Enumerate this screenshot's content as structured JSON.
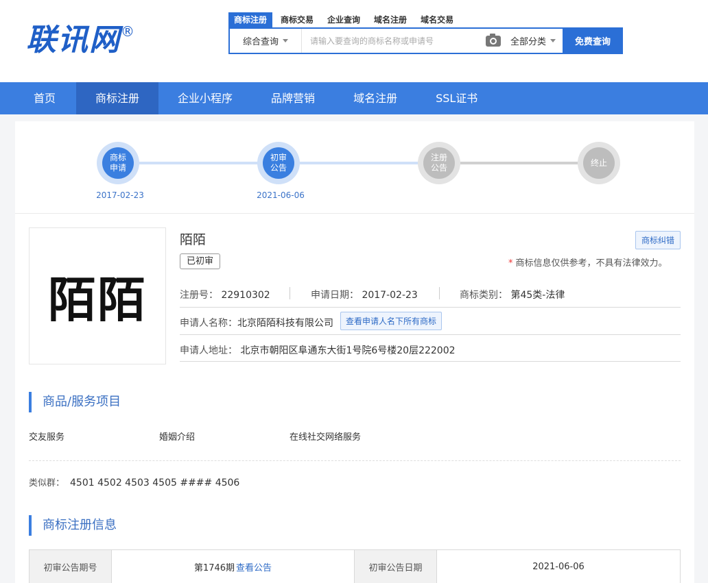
{
  "header": {
    "logo_text": "联讯网",
    "logo_reg": "®",
    "search_tabs": [
      "商标注册",
      "商标交易",
      "企业查询",
      "域名注册",
      "域名交易"
    ],
    "search_scope": "综合查询",
    "search_placeholder": "请输入要查询的商标名称或申请号",
    "category": "全部分类",
    "search_button": "免费查询"
  },
  "nav": [
    "首页",
    "商标注册",
    "企业小程序",
    "品牌营销",
    "域名注册",
    "SSL证书"
  ],
  "progress": {
    "steps": [
      {
        "label": "商标\n申请",
        "date": "2017-02-23"
      },
      {
        "label": "初审\n公告",
        "date": "2021-06-06"
      },
      {
        "label": "注册\n公告",
        "date": ""
      },
      {
        "label": "终止",
        "date": ""
      }
    ]
  },
  "trademark": {
    "image_text": "陌陌",
    "name": "陌陌",
    "status": "已初审",
    "correction_button": "商标纠错",
    "disclaimer_star": "*",
    "disclaimer": "商标信息仅供参考，不具有法律效力。",
    "reg_no_label": "注册号：",
    "reg_no": "22910302",
    "apply_date_label": "申请日期：",
    "apply_date": "2017-02-23",
    "class_label": "商标类别：",
    "class": "第45类-法律",
    "applicant_label": "申请人名称：",
    "applicant": "北京陌陌科技有限公司",
    "applicant_button": "查看申请人名下所有商标",
    "address_label": "申请人地址：",
    "address": "北京市朝阳区阜通东大街1号院6号楼20层222002"
  },
  "goods": {
    "title": "商品/服务项目",
    "items": [
      "交友服务",
      "婚姻介绍",
      "在线社交网络服务"
    ],
    "similar_label": "类似群：",
    "similar_groups": "4501 4502 4503 4505 #### 4506"
  },
  "registration": {
    "title": "商标注册信息",
    "issue_label": "初审公告期号",
    "issue_value": "第1746期",
    "issue_link": "查看公告",
    "date_label": "初审公告日期",
    "date_value": "2021-06-06"
  },
  "colors": {
    "brand": "#2b6fd6",
    "nav": "#3b7ee0",
    "step_done": "#3a7fe0",
    "step_todo": "#bdbdbd"
  }
}
